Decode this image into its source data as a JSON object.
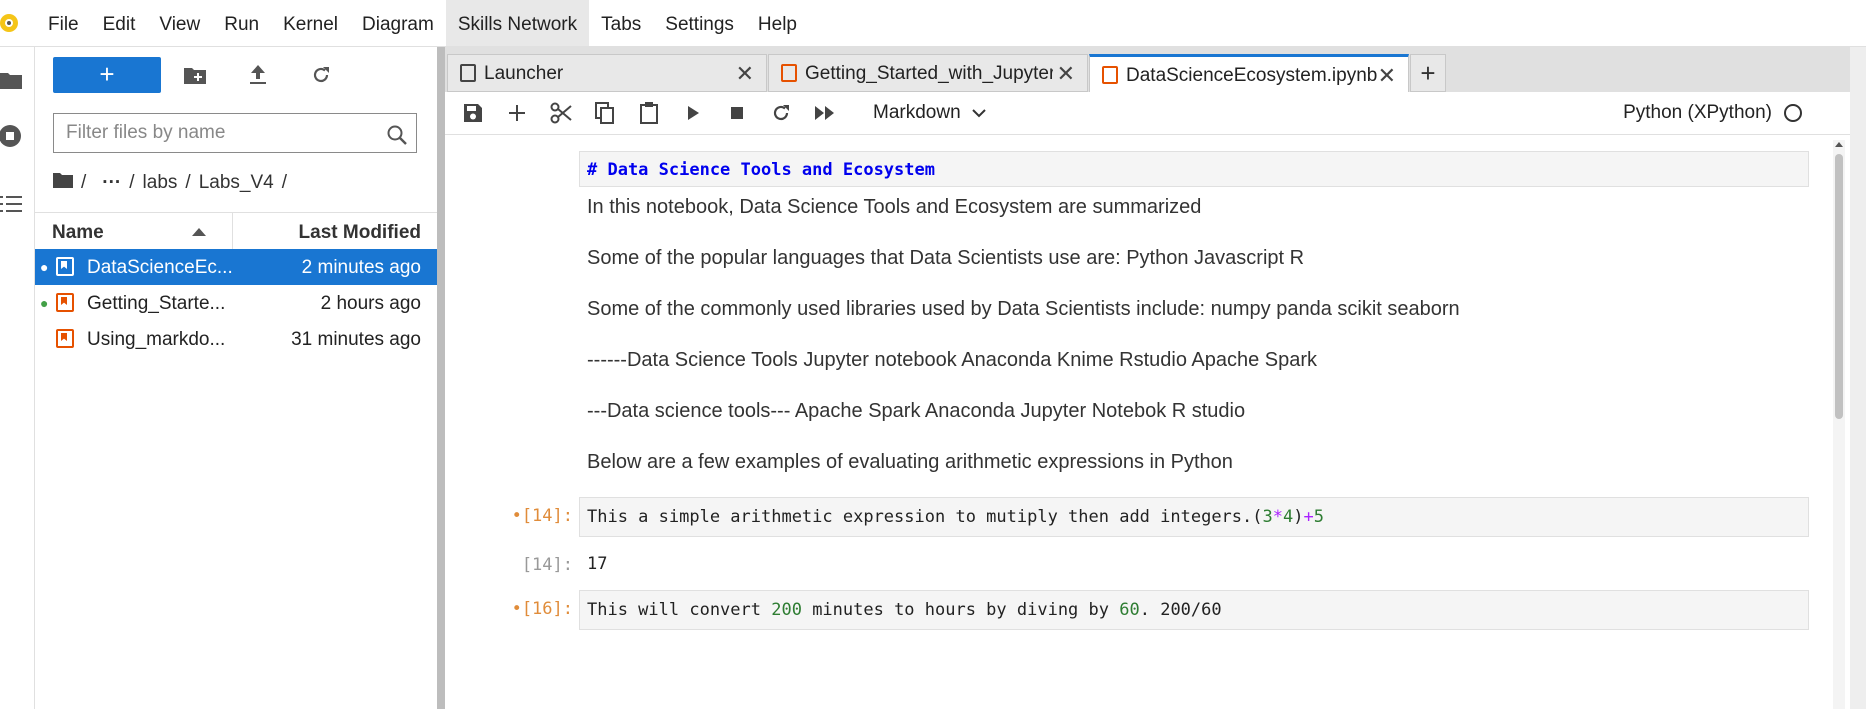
{
  "menubar": {
    "items": [
      "File",
      "Edit",
      "View",
      "Run",
      "Kernel",
      "Diagram",
      "Skills Network",
      "Tabs",
      "Settings",
      "Help"
    ],
    "active_index": 6
  },
  "filebrowser": {
    "new_button_label": "+",
    "filter_placeholder": "Filter files by name",
    "breadcrumb": {
      "root": "/",
      "ellipsis": "···",
      "parts": [
        "labs",
        "Labs_V4"
      ],
      "sep": "/"
    },
    "columns": {
      "name": "Name",
      "modified": "Last Modified"
    },
    "files": [
      {
        "name": "DataScienceEc...",
        "modified": "2 minutes ago",
        "selected": true,
        "running": true
      },
      {
        "name": "Getting_Starte...",
        "modified": "2 hours ago",
        "selected": false,
        "running": true
      },
      {
        "name": "Using_markdo...",
        "modified": "31 minutes ago",
        "selected": false,
        "running": false
      }
    ]
  },
  "tabs": [
    {
      "label": "Launcher",
      "icon": "launcher-icon"
    },
    {
      "label": "Getting_Started_with_Jupyter",
      "icon": "notebook-icon"
    },
    {
      "label": "DataScienceEcosystem.ipynb",
      "icon": "notebook-icon",
      "active": true
    }
  ],
  "notebook_toolbar": {
    "cell_type": "Markdown",
    "kernel_name": "Python (XPython)"
  },
  "cells": {
    "header_source": "# Data Science Tools and Ecosystem",
    "md1": "In this notebook, Data Science Tools and Ecosystem are summarized",
    "md2": "Some of the popular languages that Data Scientists use are: Python Javascript R",
    "md3": "Some of the commonly used libraries used by Data Scientists include: numpy panda scikit seaborn",
    "md4": "------Data Science Tools Jupyter notebook Anaconda Knime Rstudio Apache Spark",
    "md5": "---Data science tools--- Apache Spark Anaconda Jupyter Notebok R studio",
    "md6": "Below are a few examples of evaluating arithmetic expressions in Python",
    "code1_prompt": "•[14]:",
    "code1_text": "This a simple arithmetic expression to mutiply then add integers.",
    "code1_expr": {
      "open": "(",
      "a": "3",
      "op1": "*",
      "b": "4",
      "close": ")",
      "op2": "+",
      "c": "5"
    },
    "out1_prompt": "[14]:",
    "out1_value": "17",
    "code2_prompt": "•[16]:",
    "code2_text": "This will convert ",
    "code2_n": "200",
    "code2_text2": " minutes to hours by diving by ",
    "code2_d": "60",
    "code2_expr": "200/60"
  }
}
